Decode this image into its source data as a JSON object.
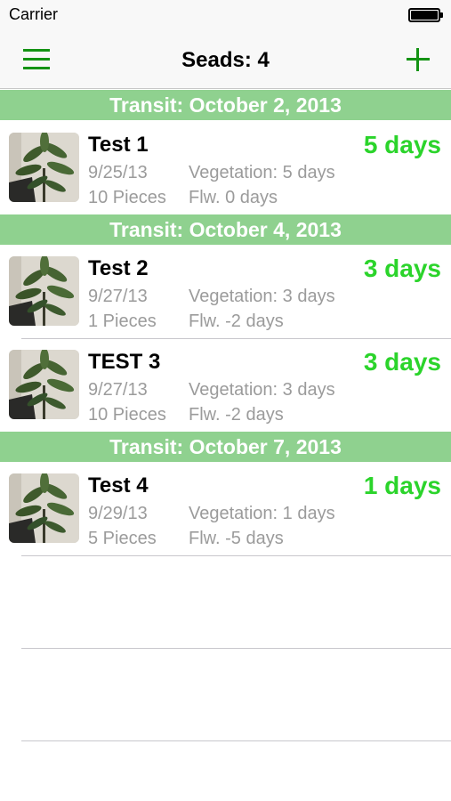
{
  "status_bar": {
    "carrier": "Carrier"
  },
  "nav": {
    "title": "Seads: 4"
  },
  "sections": [
    {
      "header": "Transit: October 2, 2013"
    },
    {
      "header": "Transit: October 4, 2013"
    },
    {
      "header": "Transit: October 7, 2013"
    }
  ],
  "rows": [
    {
      "title": "Test 1",
      "days": "5 days",
      "date": "9/25/13",
      "vegetation": "Vegetation: 5 days",
      "pieces": "10 Pieces",
      "flw": "Flw. 0 days"
    },
    {
      "title": "Test 2",
      "days": "3 days",
      "date": "9/27/13",
      "vegetation": "Vegetation: 3 days",
      "pieces": "1 Pieces",
      "flw": "Flw. -2 days"
    },
    {
      "title": "TEST 3",
      "days": "3 days",
      "date": "9/27/13",
      "vegetation": "Vegetation: 3 days",
      "pieces": "10 Pieces",
      "flw": "Flw. -2 days"
    },
    {
      "title": "Test 4",
      "days": "1 days",
      "date": "9/29/13",
      "vegetation": "Vegetation: 1 days",
      "pieces": "5 Pieces",
      "flw": "Flw. -5 days"
    }
  ],
  "colors": {
    "accent": "#149314",
    "section_header_bg": "#8fd18f",
    "days_green": "#2bd42b",
    "secondary_text": "#9b9b9b"
  },
  "icons": {
    "menu": "hamburger-menu-icon",
    "add": "plus-icon",
    "battery": "battery-icon"
  }
}
